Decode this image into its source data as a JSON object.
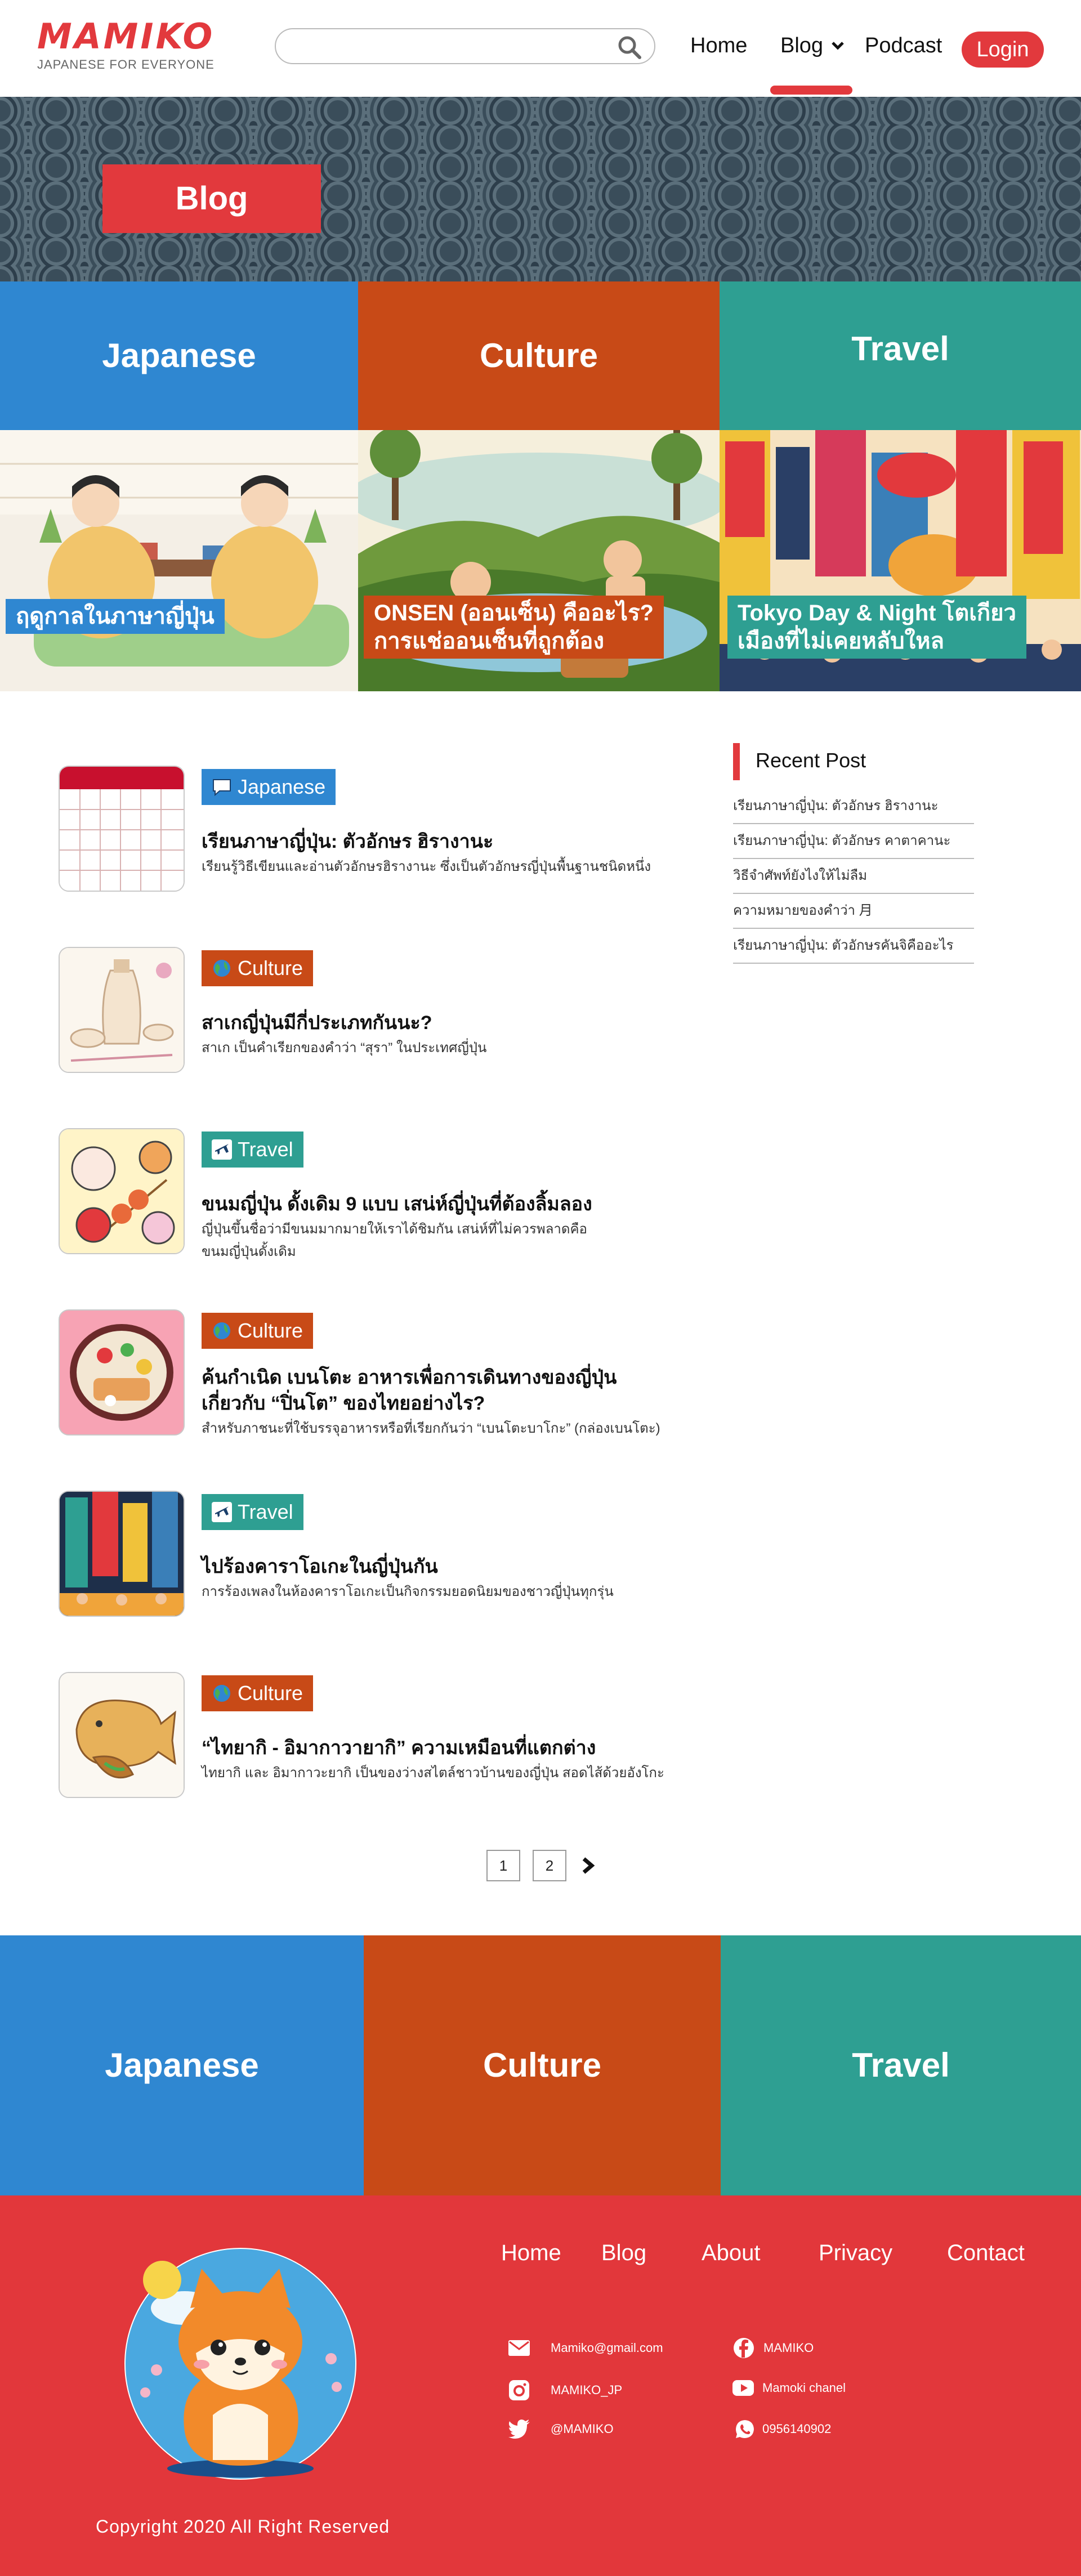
{
  "header": {
    "logo_text": "MAMIKO",
    "logo_tagline": "JAPANESE FOR EVERYONE",
    "search_placeholder": "",
    "nav": {
      "home": "Home",
      "blog": "Blog",
      "podcast": "Podcast",
      "login": "Login"
    }
  },
  "hero": {
    "badge": "Blog"
  },
  "categories": {
    "japanese": "Japanese",
    "culture": "Culture",
    "travel": "Travel"
  },
  "features": [
    {
      "label": "ฤดูกาลในภาษาญี่ปุ่น"
    },
    {
      "label_line1": "ONSEN (ออนเซ็น) คืออะไร?",
      "label_line2": "การแช่ออนเซ็นที่ถูกต้อง"
    },
    {
      "label_line1": "Tokyo Day & Night โตเกียว",
      "label_line2": "เมืองที่ไม่เคยหลับใหล"
    }
  ],
  "posts": [
    {
      "tag": "Japanese",
      "title": "เรียนภาษาญี่ปุ่น: ตัวอักษร ฮิรางานะ",
      "excerpt": "เรียนรู้วิธีเขียนและอ่านตัวอักษรฮิรางานะ ซึ่งเป็นตัวอักษรญี่ปุ่นพื้นฐานชนิดหนึ่ง"
    },
    {
      "tag": "Culture",
      "title": "สาเกญี่ปุ่นมีกี่ประเภทกันนะ?",
      "excerpt": "สาเก เป็นคำเรียกของคำว่า “สุรา” ในประเทศญี่ปุ่น"
    },
    {
      "tag": "Travel",
      "title": "ขนมญี่ปุ่น ดั้งเดิม 9 แบบ เสน่ห์ญี่ปุ่นที่ต้องลิ้มลอง",
      "excerpt_line1": "ญี่ปุ่นขึ้นชื่อว่ามีขนมมากมายให้เราได้ชิมกัน เสน่ห์ที่ไม่ควรพลาดคือ",
      "excerpt_line2": "ขนมญี่ปุ่นดั้งเดิม"
    },
    {
      "tag": "Culture",
      "title_line1": "ค้นกำเนิด เบนโตะ อาหารเพื่อการเดินทางของญี่ปุ่น",
      "title_line2": "เกี่ยวกับ “ปิ่นโต” ของไทยอย่างไร?",
      "excerpt": "สำหรับภาชนะที่ใช้บรรจุอาหารหรือที่เรียกกันว่า “เบนโตะบาโกะ” (กล่องเบนโตะ)"
    },
    {
      "tag": "Travel",
      "title": "ไปร้องคาราโอเกะในญี่ปุ่นกัน",
      "excerpt": "การร้องเพลงในห้องคาราโอเกะเป็นกิจกรรมยอดนิยมของชาวญี่ปุ่นทุกรุ่น"
    },
    {
      "tag": "Culture",
      "title": "“ไทยากิ - อิมากาวายากิ” ความเหมือนที่แตกต่าง",
      "excerpt": "ไทยากิ และ อิมากาวะยากิ เป็นของว่างสไตล์ชาวบ้านของญี่ปุ่น สอดไส้ด้วยอังโกะ"
    }
  ],
  "sidebar": {
    "title": "Recent Post",
    "items": [
      "เรียนภาษาญี่ปุ่น: ตัวอักษร ฮิรางานะ",
      "เรียนภาษาญี่ปุ่น: ตัวอักษร คาตาคานะ",
      "วิธีจำศัพท์ยังไงให้ไม่ลืม",
      "ความหมายของคำว่า 月",
      "เรียนภาษาญี่ปุ่น: ตัวอักษรคันจิคืออะไร"
    ]
  },
  "pagination": {
    "pages": [
      "1",
      "2"
    ]
  },
  "footer": {
    "nav": {
      "home": "Home",
      "blog": "Blog",
      "about": "About",
      "privacy": "Privacy",
      "contact": "Contact"
    },
    "contacts": {
      "email": "Mamiko@gmail.com",
      "facebook": "MAMIKO",
      "instagram": "MAMIKO_JP",
      "youtube": "Mamoki chanel",
      "twitter": "@MAMIKO",
      "whatsapp": "0956140902"
    },
    "copyright": "Copyright 2020 All Right Reserved"
  },
  "colors": {
    "brand_red": "#e2393d",
    "japanese_blue": "#2f87d1",
    "culture_orange": "#c84a17",
    "travel_teal": "#2e9f92"
  },
  "icons": [
    "search-icon",
    "chevron-down-icon",
    "chat-bubble-icon",
    "globe-icon",
    "airplane-icon",
    "chevron-right-icon",
    "mail-icon",
    "facebook-icon",
    "instagram-icon",
    "youtube-icon",
    "twitter-icon",
    "whatsapp-icon"
  ]
}
